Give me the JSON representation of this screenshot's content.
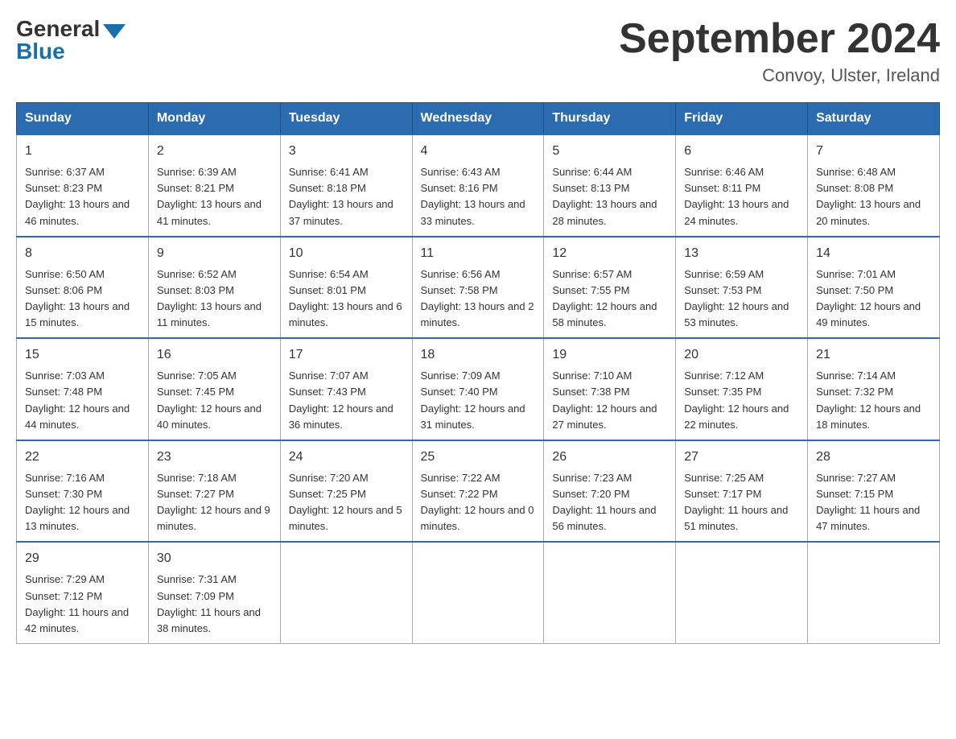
{
  "header": {
    "logo": {
      "general": "General",
      "blue": "Blue"
    },
    "title": "September 2024",
    "location": "Convoy, Ulster, Ireland"
  },
  "days_of_week": [
    "Sunday",
    "Monday",
    "Tuesday",
    "Wednesday",
    "Thursday",
    "Friday",
    "Saturday"
  ],
  "weeks": [
    [
      {
        "day": "1",
        "sunrise": "6:37 AM",
        "sunset": "8:23 PM",
        "daylight": "13 hours and 46 minutes."
      },
      {
        "day": "2",
        "sunrise": "6:39 AM",
        "sunset": "8:21 PM",
        "daylight": "13 hours and 41 minutes."
      },
      {
        "day": "3",
        "sunrise": "6:41 AM",
        "sunset": "8:18 PM",
        "daylight": "13 hours and 37 minutes."
      },
      {
        "day": "4",
        "sunrise": "6:43 AM",
        "sunset": "8:16 PM",
        "daylight": "13 hours and 33 minutes."
      },
      {
        "day": "5",
        "sunrise": "6:44 AM",
        "sunset": "8:13 PM",
        "daylight": "13 hours and 28 minutes."
      },
      {
        "day": "6",
        "sunrise": "6:46 AM",
        "sunset": "8:11 PM",
        "daylight": "13 hours and 24 minutes."
      },
      {
        "day": "7",
        "sunrise": "6:48 AM",
        "sunset": "8:08 PM",
        "daylight": "13 hours and 20 minutes."
      }
    ],
    [
      {
        "day": "8",
        "sunrise": "6:50 AM",
        "sunset": "8:06 PM",
        "daylight": "13 hours and 15 minutes."
      },
      {
        "day": "9",
        "sunrise": "6:52 AM",
        "sunset": "8:03 PM",
        "daylight": "13 hours and 11 minutes."
      },
      {
        "day": "10",
        "sunrise": "6:54 AM",
        "sunset": "8:01 PM",
        "daylight": "13 hours and 6 minutes."
      },
      {
        "day": "11",
        "sunrise": "6:56 AM",
        "sunset": "7:58 PM",
        "daylight": "13 hours and 2 minutes."
      },
      {
        "day": "12",
        "sunrise": "6:57 AM",
        "sunset": "7:55 PM",
        "daylight": "12 hours and 58 minutes."
      },
      {
        "day": "13",
        "sunrise": "6:59 AM",
        "sunset": "7:53 PM",
        "daylight": "12 hours and 53 minutes."
      },
      {
        "day": "14",
        "sunrise": "7:01 AM",
        "sunset": "7:50 PM",
        "daylight": "12 hours and 49 minutes."
      }
    ],
    [
      {
        "day": "15",
        "sunrise": "7:03 AM",
        "sunset": "7:48 PM",
        "daylight": "12 hours and 44 minutes."
      },
      {
        "day": "16",
        "sunrise": "7:05 AM",
        "sunset": "7:45 PM",
        "daylight": "12 hours and 40 minutes."
      },
      {
        "day": "17",
        "sunrise": "7:07 AM",
        "sunset": "7:43 PM",
        "daylight": "12 hours and 36 minutes."
      },
      {
        "day": "18",
        "sunrise": "7:09 AM",
        "sunset": "7:40 PM",
        "daylight": "12 hours and 31 minutes."
      },
      {
        "day": "19",
        "sunrise": "7:10 AM",
        "sunset": "7:38 PM",
        "daylight": "12 hours and 27 minutes."
      },
      {
        "day": "20",
        "sunrise": "7:12 AM",
        "sunset": "7:35 PM",
        "daylight": "12 hours and 22 minutes."
      },
      {
        "day": "21",
        "sunrise": "7:14 AM",
        "sunset": "7:32 PM",
        "daylight": "12 hours and 18 minutes."
      }
    ],
    [
      {
        "day": "22",
        "sunrise": "7:16 AM",
        "sunset": "7:30 PM",
        "daylight": "12 hours and 13 minutes."
      },
      {
        "day": "23",
        "sunrise": "7:18 AM",
        "sunset": "7:27 PM",
        "daylight": "12 hours and 9 minutes."
      },
      {
        "day": "24",
        "sunrise": "7:20 AM",
        "sunset": "7:25 PM",
        "daylight": "12 hours and 5 minutes."
      },
      {
        "day": "25",
        "sunrise": "7:22 AM",
        "sunset": "7:22 PM",
        "daylight": "12 hours and 0 minutes."
      },
      {
        "day": "26",
        "sunrise": "7:23 AM",
        "sunset": "7:20 PM",
        "daylight": "11 hours and 56 minutes."
      },
      {
        "day": "27",
        "sunrise": "7:25 AM",
        "sunset": "7:17 PM",
        "daylight": "11 hours and 51 minutes."
      },
      {
        "day": "28",
        "sunrise": "7:27 AM",
        "sunset": "7:15 PM",
        "daylight": "11 hours and 47 minutes."
      }
    ],
    [
      {
        "day": "29",
        "sunrise": "7:29 AM",
        "sunset": "7:12 PM",
        "daylight": "11 hours and 42 minutes."
      },
      {
        "day": "30",
        "sunrise": "7:31 AM",
        "sunset": "7:09 PM",
        "daylight": "11 hours and 38 minutes."
      },
      null,
      null,
      null,
      null,
      null
    ]
  ]
}
